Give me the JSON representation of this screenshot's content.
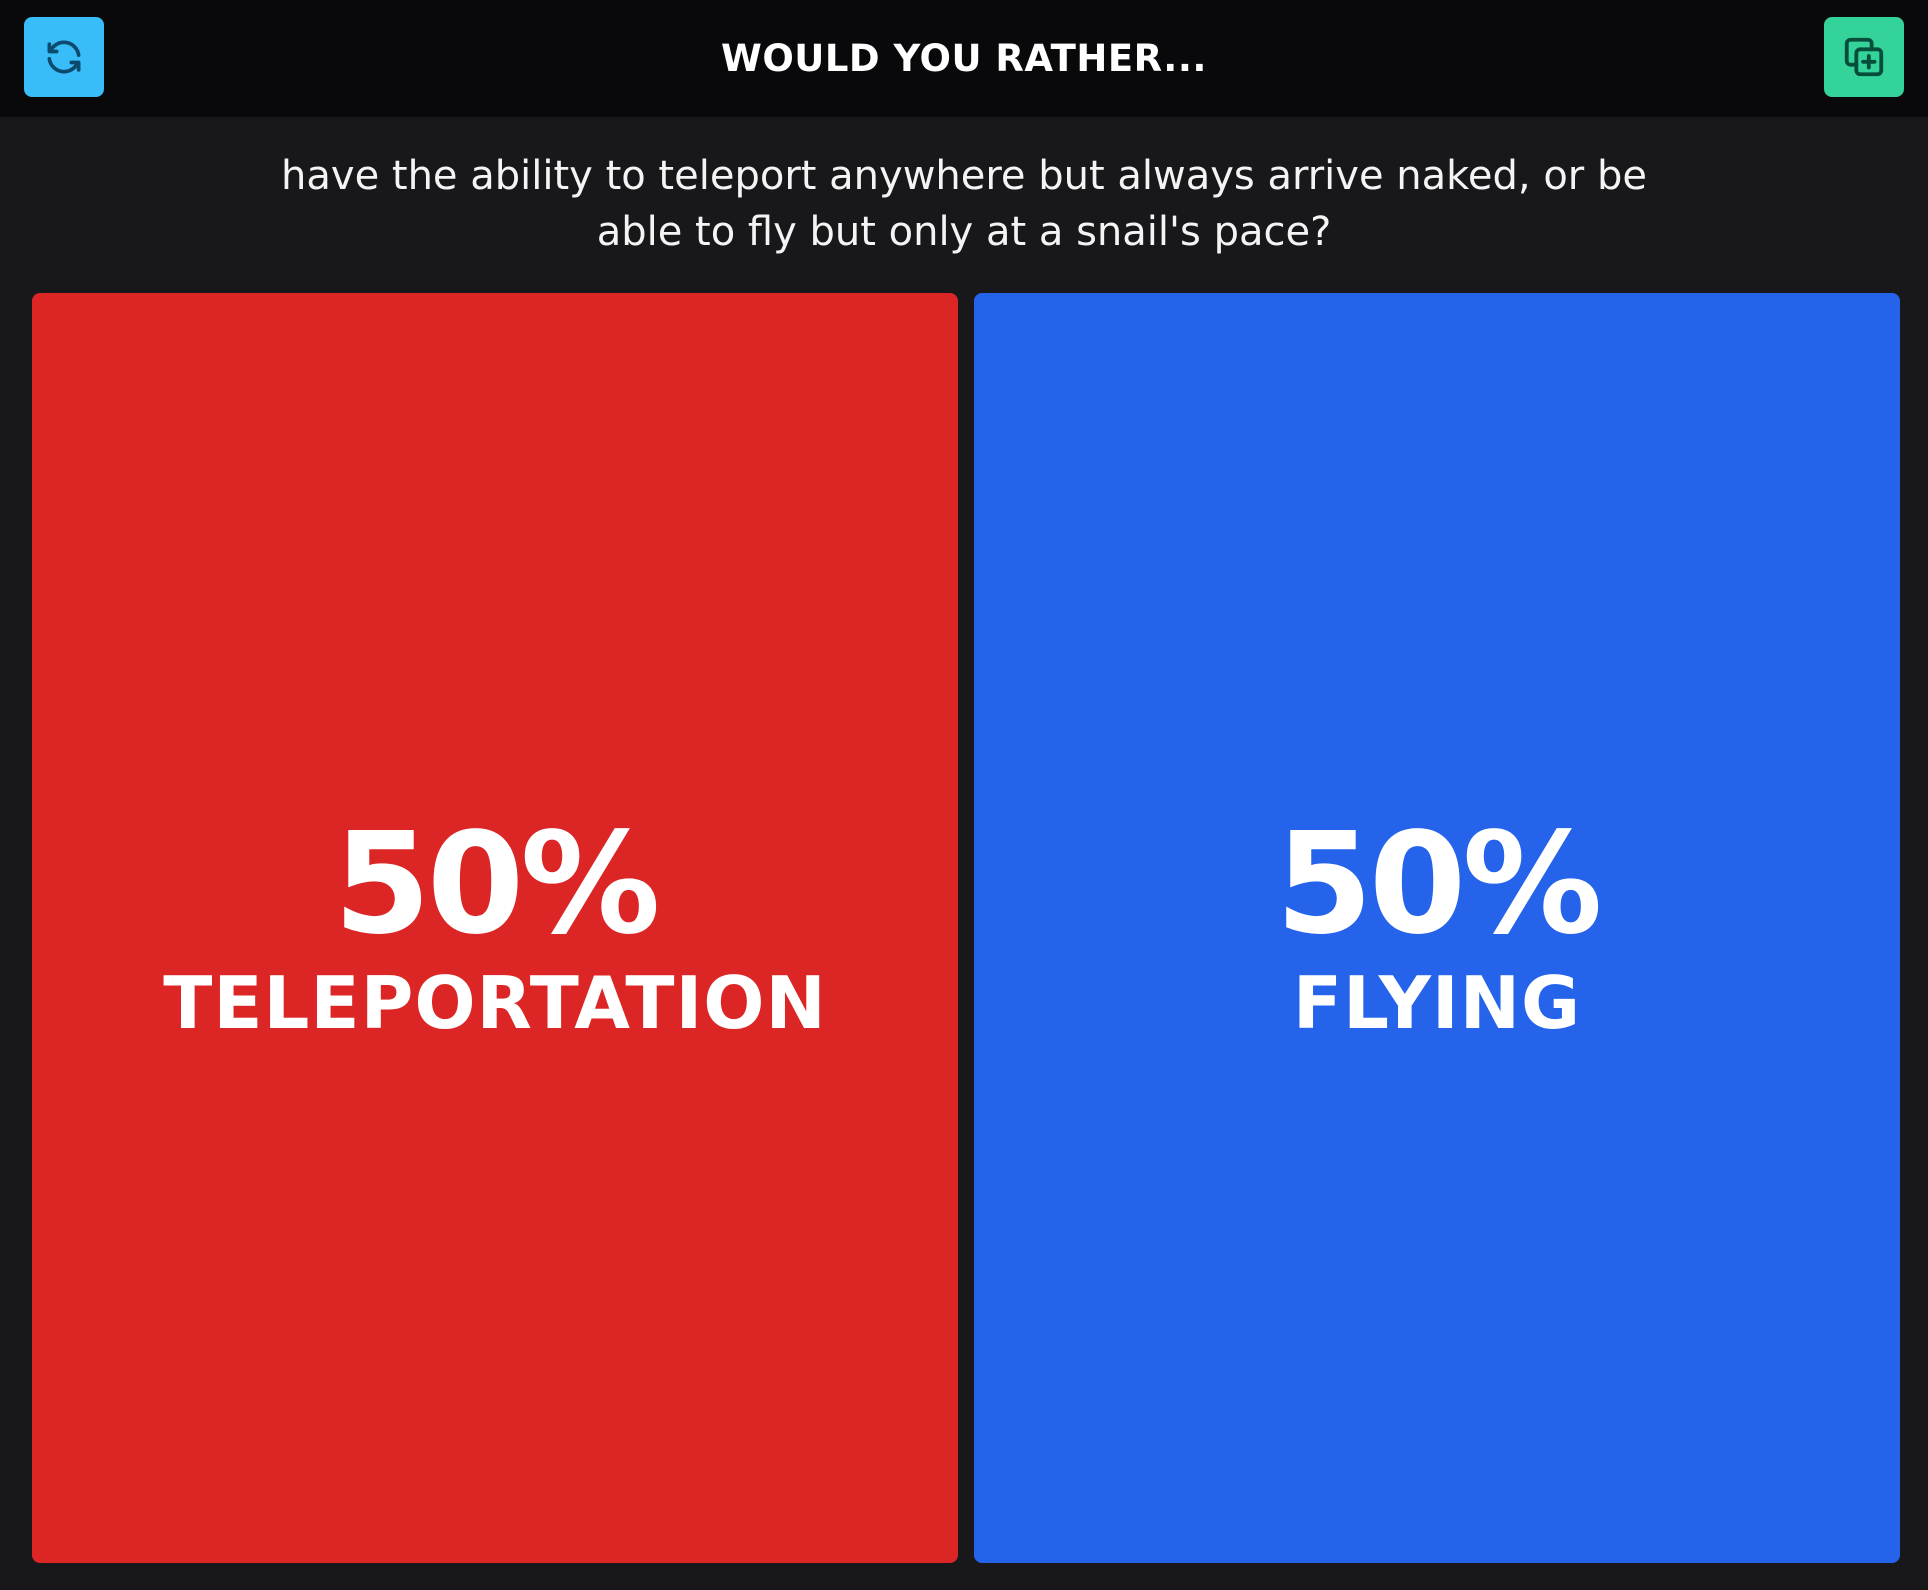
{
  "header": {
    "title": "WOULD YOU RATHER...",
    "refresh_button": {
      "icon": "refresh-icon",
      "color": "#38bdf8"
    },
    "add_button": {
      "icon": "copy-plus-icon",
      "color": "#34d399"
    }
  },
  "question": {
    "text": "have the ability to teleport anywhere but always arrive naked, or be able to fly but only at a snail's pace?"
  },
  "options": [
    {
      "percent": "50%",
      "label": "TELEPORTATION",
      "color": "#dc2626"
    },
    {
      "percent": "50%",
      "label": "FLYING",
      "color": "#2563eb"
    }
  ]
}
